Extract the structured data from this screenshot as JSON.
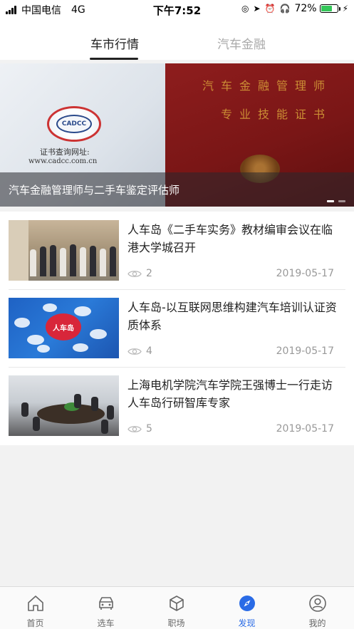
{
  "status_bar": {
    "carrier": "中国电信",
    "network": "4G",
    "time": "下午7:52",
    "battery": "72%",
    "battery_level": 0.72
  },
  "tabs": [
    {
      "label": "车市行情",
      "active": true
    },
    {
      "label": "汽车金融",
      "active": false
    }
  ],
  "banner": {
    "caption": "汽车金融管理师与二手车鉴定评估师",
    "logo_text": "CADCC",
    "cert_line1": "证书查询网址:",
    "cert_line2": "www.cadcc.com.cn",
    "cert_title1": "汽车金融管理师",
    "cert_title2": "专业技能证书"
  },
  "news": [
    {
      "title": "人车岛《二手车实务》教材编审会议在临港大学城召开",
      "views": "2",
      "date": "2019-05-17"
    },
    {
      "title": "人车岛-以互联网思维构建汽车培训认证资质体系",
      "views": "4",
      "date": "2019-05-17",
      "thumb_text": "人车岛"
    },
    {
      "title": "上海电机学院汽车学院王强博士一行走访人车岛行研智库专家",
      "views": "5",
      "date": "2019-05-17"
    }
  ],
  "bottom_nav": [
    {
      "label": "首页",
      "icon": "home-icon",
      "active": false
    },
    {
      "label": "选车",
      "icon": "car-icon",
      "active": false
    },
    {
      "label": "职场",
      "icon": "cube-icon",
      "active": false
    },
    {
      "label": "发现",
      "icon": "compass-icon",
      "active": true
    },
    {
      "label": "我的",
      "icon": "user-icon",
      "active": false
    }
  ],
  "colors": {
    "accent": "#2a6be6",
    "banner_red": "#7a1616",
    "muted_text": "#999999"
  }
}
